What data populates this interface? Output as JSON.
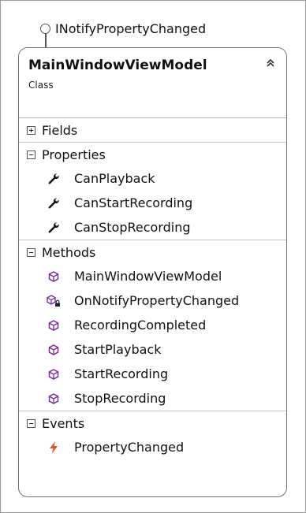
{
  "interface": {
    "name": "INotifyPropertyChanged",
    "icon": "lollipop-interface-icon"
  },
  "class": {
    "name": "MainWindowViewModel",
    "kind": "Class",
    "collapse_icon": "double-chevron-up-icon"
  },
  "sections": {
    "fields": {
      "title": "Fields",
      "state": "collapsed"
    },
    "properties": {
      "title": "Properties",
      "state": "expanded",
      "items": [
        "CanPlayback",
        "CanStartRecording",
        "CanStopRecording"
      ],
      "icon": "wrench-property-icon"
    },
    "methods": {
      "title": "Methods",
      "state": "expanded",
      "items": [
        "MainWindowViewModel",
        "OnNotifyPropertyChanged",
        "RecordingCompleted",
        "StartPlayback",
        "StartRecording",
        "StopRecording"
      ],
      "icon": "method-cube-icon",
      "private_icon": "private-method-cube-icon"
    },
    "events": {
      "title": "Events",
      "state": "expanded",
      "items": [
        "PropertyChanged"
      ],
      "icon": "lightning-event-icon"
    }
  },
  "colors": {
    "method": "#7a2c9e",
    "event": "#e0502a",
    "border": "#6f6f6f"
  }
}
